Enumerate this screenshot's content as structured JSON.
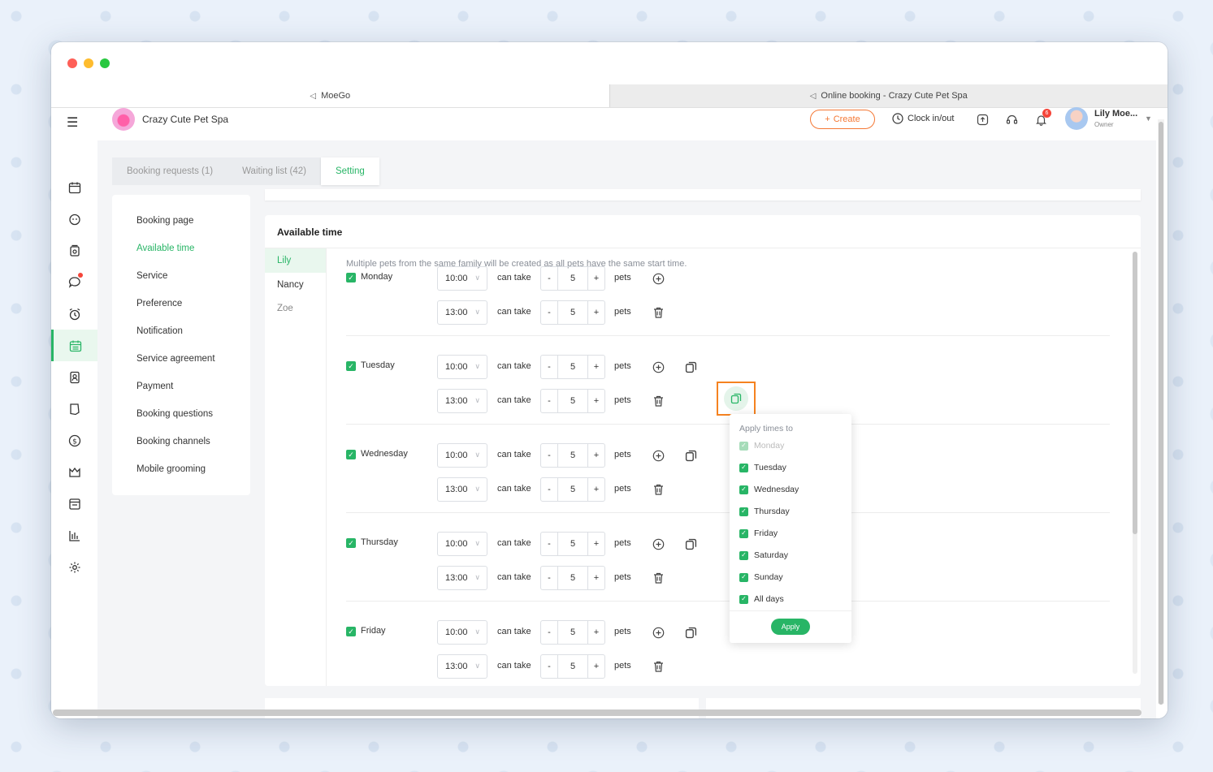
{
  "browser": {
    "tabs": [
      {
        "label": "MoeGo",
        "active": true
      },
      {
        "label": "Online booking - Crazy Cute Pet Spa",
        "active": false
      }
    ]
  },
  "header": {
    "business_name": "Crazy Cute Pet Spa",
    "create_label": "Create",
    "clock_label": "Clock in/out",
    "notification_count": "6",
    "user_name": "Lily Moe...",
    "user_role": "Owner"
  },
  "page_tabs": [
    {
      "label": "Booking requests (1)"
    },
    {
      "label": "Waiting list (42)"
    },
    {
      "label": "Setting"
    }
  ],
  "settings_menu": [
    {
      "label": "Booking page"
    },
    {
      "label": "Available time"
    },
    {
      "label": "Service"
    },
    {
      "label": "Preference"
    },
    {
      "label": "Notification"
    },
    {
      "label": "Service agreement"
    },
    {
      "label": "Payment"
    },
    {
      "label": "Booking questions"
    },
    {
      "label": "Booking channels"
    },
    {
      "label": "Mobile grooming"
    }
  ],
  "available_time": {
    "title": "Available time",
    "notice": "Multiple pets from the same family will be created as all pets have the same start time.",
    "staff": [
      {
        "name": "Lily"
      },
      {
        "name": "Nancy"
      },
      {
        "name": "Zoe"
      }
    ],
    "can_take_label": "can take",
    "pets_label": "pets",
    "days": [
      {
        "name": "Monday",
        "slots": [
          {
            "time": "10:00",
            "count": "5"
          },
          {
            "time": "13:00",
            "count": "5"
          }
        ]
      },
      {
        "name": "Tuesday",
        "slots": [
          {
            "time": "10:00",
            "count": "5"
          },
          {
            "time": "13:00",
            "count": "5"
          }
        ]
      },
      {
        "name": "Wednesday",
        "slots": [
          {
            "time": "10:00",
            "count": "5"
          },
          {
            "time": "13:00",
            "count": "5"
          }
        ]
      },
      {
        "name": "Thursday",
        "slots": [
          {
            "time": "10:00",
            "count": "5"
          },
          {
            "time": "13:00",
            "count": "5"
          }
        ]
      },
      {
        "name": "Friday",
        "slots": [
          {
            "time": "10:00",
            "count": "5"
          },
          {
            "time": "13:00",
            "count": "5"
          }
        ]
      }
    ]
  },
  "apply_popover": {
    "title": "Apply times to",
    "items": [
      {
        "label": "Monday",
        "checked": true,
        "disabled": true
      },
      {
        "label": "Tuesday",
        "checked": true
      },
      {
        "label": "Wednesday",
        "checked": true
      },
      {
        "label": "Thursday",
        "checked": true
      },
      {
        "label": "Friday",
        "checked": true
      },
      {
        "label": "Saturday",
        "checked": true
      },
      {
        "label": "Sunday",
        "checked": true
      },
      {
        "label": "All days",
        "checked": true
      }
    ],
    "apply_label": "Apply"
  },
  "colors": {
    "accent_green": "#28b566",
    "accent_orange": "#f47835",
    "highlight_orange": "#f58220"
  }
}
